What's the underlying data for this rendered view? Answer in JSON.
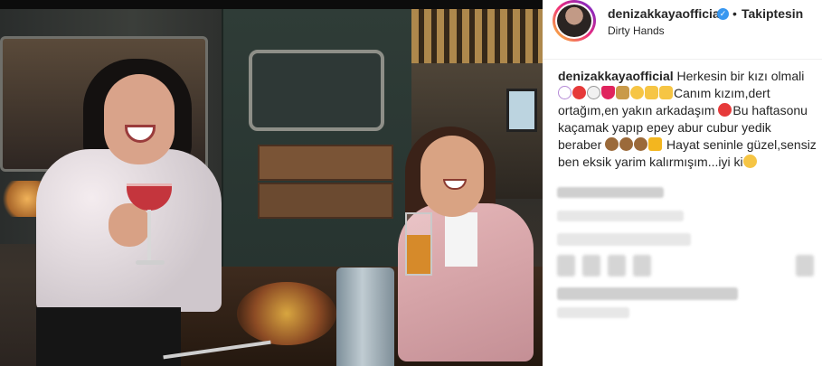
{
  "post": {
    "photo": {
      "description_icon": "photo-icon"
    }
  },
  "header": {
    "username": "denizakkayaofficial",
    "verified_icon": "verified-badge-icon",
    "separator": "•",
    "follow_label": "Takiptesin",
    "location": "Dirty Hands"
  },
  "caption": {
    "username": "denizakkayaofficial",
    "line1": "Herkesin bir kızı olmali",
    "part2": "Canım kızım,dert ortağım,en yakın arkadaşım",
    "part3": "Bu haftasonu kaçamak yapıp epey abur cubur yedik beraber",
    "part4": "Hayat seninle güzel,sensiz ben eksik yarim kalırmışım...iyi ki",
    "emojis_line2": [
      "unicorn",
      "balloon",
      "ghost",
      "heart",
      "camel",
      "grinning",
      "thumbs-up",
      "ok-hand"
    ],
    "emojis_line5": [
      "see-no-evil-monkey",
      "see-no-evil-monkey",
      "see-no-evil-monkey",
      "crown"
    ],
    "emoji_end": "hugging-face",
    "balloon_emoji": "balloon"
  },
  "colors": {
    "accent_blue": "#3897f0",
    "text": "#262626",
    "border": "#efefef"
  }
}
